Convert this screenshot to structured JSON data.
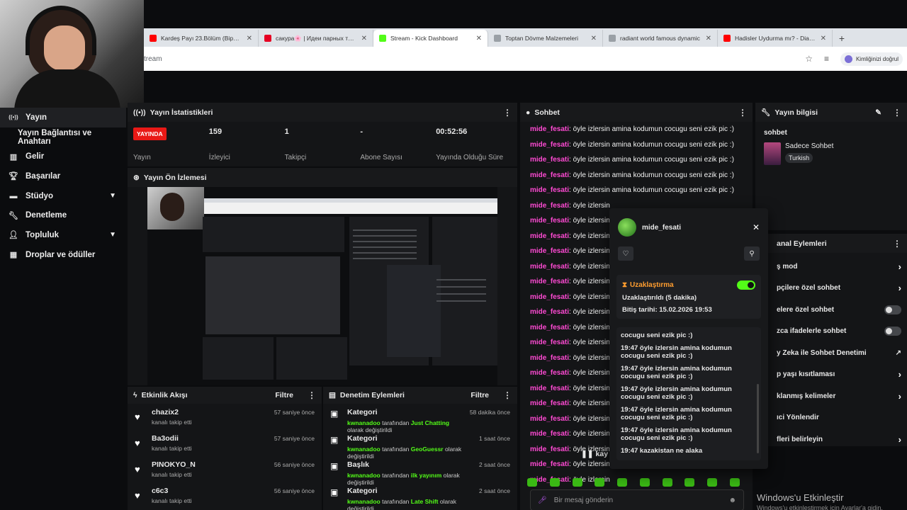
{
  "browser": {
    "tabs": [
      {
        "title": "Kardeş Payı 23.Bölüm (Bipsiz Ver",
        "color": "#ff0000"
      },
      {
        "title": "сакура🌸 | Идеи парных тату",
        "color": "#e60023"
      },
      {
        "title": "Stream - Kick Dashboard",
        "color": "#53fc18"
      },
      {
        "title": "Toptan Dövme Malzemeleri",
        "color": "#9aa0a6"
      },
      {
        "title": "radiant world famous dynamic",
        "color": "#9aa0a6"
      },
      {
        "title": "Hadisler Uydurma mı? - Diamo",
        "color": "#ff0000"
      }
    ],
    "address": "tream",
    "profile_label": "Kimliğinizi doğrul"
  },
  "sidebar": {
    "items": [
      {
        "label": "Yayın",
        "icon": "broadcast-icon"
      },
      {
        "label": "Yayın Bağlantısı ve Anahtarı",
        "icon": ""
      },
      {
        "label": "Gelir",
        "icon": "revenue-icon"
      },
      {
        "label": "Başarılar",
        "icon": "trophy-icon"
      },
      {
        "label": "Stüdyo",
        "icon": "studio-icon"
      },
      {
        "label": "Denetleme",
        "icon": "wrench-icon"
      },
      {
        "label": "Topluluk",
        "icon": "community-icon"
      },
      {
        "label": "Droplar ve ödüller",
        "icon": "gift-icon"
      }
    ]
  },
  "stats_panel": {
    "title": "Yayın İstatistikleri",
    "live_badge": "YAYINDA",
    "status_label": "Yayın",
    "viewers_value": "159",
    "viewers_label": "İzleyici",
    "followers_value": "1",
    "followers_label": "Takipçi",
    "subs_value": "-",
    "subs_label": "Abone Sayısı",
    "duration_value": "00:52:56",
    "duration_label": "Yayında Olduğu Süre"
  },
  "preview_panel": {
    "title": "Yayın Ön İzlemesi"
  },
  "events_panel": {
    "title": "Etkinlik Akışı",
    "filter": "Filtre",
    "items": [
      {
        "name": "chazix2",
        "sub": "kanalı takip etti",
        "time": "57 saniye önce"
      },
      {
        "name": "Ba3odii",
        "sub": "kanalı takip etti",
        "time": "57 saniye önce"
      },
      {
        "name": "PINOKYO_N",
        "sub": "kanalı takip etti",
        "time": "56 saniye önce"
      },
      {
        "name": "c6c3",
        "sub": "kanalı takip etti",
        "time": "56 saniye önce"
      }
    ]
  },
  "mod_panel": {
    "title": "Denetim Eylemleri",
    "filter": "Filtre",
    "items": [
      {
        "name": "Kategori",
        "user": "kwnanadoo",
        "mid": " tarafından ",
        "target": "Just Chatting",
        "end": " olarak değiştirildi",
        "time": "58 dakika önce"
      },
      {
        "name": "Kategori",
        "user": "kwnanadoo",
        "mid": " tarafından ",
        "target": "GeoGuessr",
        "end": " olarak değiştirildi",
        "time": "1 saat önce"
      },
      {
        "name": "Başlık",
        "user": "kwnanadoo",
        "mid": " tarafından ",
        "target": "ilk yayınım",
        "end": " olarak değiştirildi",
        "time": "2 saat önce"
      },
      {
        "name": "Kategori",
        "user": "kwnanadoo",
        "mid": " tarafından ",
        "target": "Late Shift",
        "end": " olarak değiştirildi",
        "time": "2 saat önce"
      }
    ]
  },
  "chat_panel": {
    "title": "Sohbet",
    "messages": [
      {
        "user": "mide_fesati",
        "text": ": öyle izlersin amina kodumun cocugu seni ezik pic :)"
      },
      {
        "user": "mide_fesati",
        "text": ": öyle izlersin amina kodumun cocugu seni ezik pic :)"
      },
      {
        "user": "mide_fesati",
        "text": ": öyle izlersin amina kodumun cocugu seni ezik pic :)"
      },
      {
        "user": "mide_fesati",
        "text": ": öyle izlersin amina kodumun cocugu seni ezik pic :)"
      },
      {
        "user": "mide_fesati",
        "text": ": öyle izlersin amina kodumun cocugu seni ezik pic :)"
      },
      {
        "user": "mide_fesati",
        "text": ": öyle izlersin"
      },
      {
        "user": "mide_fesati",
        "text": ": öyle izlersin"
      },
      {
        "user": "mide_fesati",
        "text": ": öyle izlersin"
      },
      {
        "user": "mide_fesati",
        "text": ": öyle izlersin"
      },
      {
        "user": "mide_fesati",
        "text": ": öyle izlersin"
      },
      {
        "user": "mide_fesati",
        "text": ": öyle izlersin"
      },
      {
        "user": "mide_fesati",
        "text": ": öyle izlersin"
      },
      {
        "user": "mide_fesati",
        "text": ": öyle izlersin"
      },
      {
        "user": "mide_fesati",
        "text": ": öyle izlersin"
      },
      {
        "user": "mide_fesati",
        "text": ": öyle izlersin"
      },
      {
        "user": "mide_fesati",
        "text": ": öyle izlersin"
      },
      {
        "user": "mide_fesati",
        "text": ": öyle izlersin"
      },
      {
        "user": "mide_fesati",
        "text": ": öyle izlersin"
      },
      {
        "user": "mide_fesati",
        "text": ": öyle izlersin"
      },
      {
        "user": "mide_fesati",
        "text": ": öyle izlersin"
      },
      {
        "user": "mide_fesati",
        "text": ": öyle izlersin"
      },
      {
        "user": "mide_fesati",
        "text": ": öyle izlersin"
      },
      {
        "user": "mide_fesati",
        "text": ": öyle izlersin"
      },
      {
        "user": "mide_fesati",
        "text": ": öyle izlersin"
      }
    ],
    "paused_label": "❚❚ kay",
    "input_placeholder": "Bir mesaj gönderin"
  },
  "info_panel": {
    "title": "Yayın bilgisi",
    "section": "sohbet",
    "category": "Sadece Sohbet",
    "language": "Turkish"
  },
  "actions_panel": {
    "title": "anal Eylemleri",
    "items": [
      {
        "label": "ş mod",
        "control": "chevron"
      },
      {
        "label": "pçilere özel sohbet",
        "control": "chevron"
      },
      {
        "label": "elere özel sohbet",
        "control": "toggle"
      },
      {
        "label": "zca ifadelerle sohbet",
        "control": "toggle"
      },
      {
        "label": "y Zeka ile Sohbet Denetimi",
        "control": "external"
      },
      {
        "label": "p yaşı kısıtlaması",
        "control": "chevron"
      },
      {
        "label": "klanmış kelimeler",
        "control": "chevron"
      },
      {
        "label": "ıci Yönlendir",
        "control": "none"
      },
      {
        "label": "fleri belirleyin",
        "control": "chevron"
      }
    ]
  },
  "popup": {
    "username": "mide_fesati",
    "timeout_title": "Uzaklaştırma",
    "timeout_status": "Uzaklaştırıldı (5 dakika)",
    "timeout_end": "Bitiş tarihi: 15.02.2026 19:53",
    "history": [
      "cocugu seni ezik pic :)",
      "19:47 öyle izlersin amina kodumun cocugu seni ezik pic :)",
      "19:47 öyle izlersin amina kodumun cocugu seni ezik pic :)",
      "19:47 öyle izlersin amina kodumun cocugu seni ezik pic :)",
      "19:47 öyle izlersin amina kodumun cocugu seni ezik pic :)",
      "19:47 öyle izlersin amina kodumun cocugu seni ezik pic :)",
      "19:47 kazakistan ne alaka"
    ]
  },
  "watermark": {
    "line1": "Windows'u Etkinleştir",
    "line2": "Windows'u etkinleştirmek için Ayarlar'a gidin."
  }
}
